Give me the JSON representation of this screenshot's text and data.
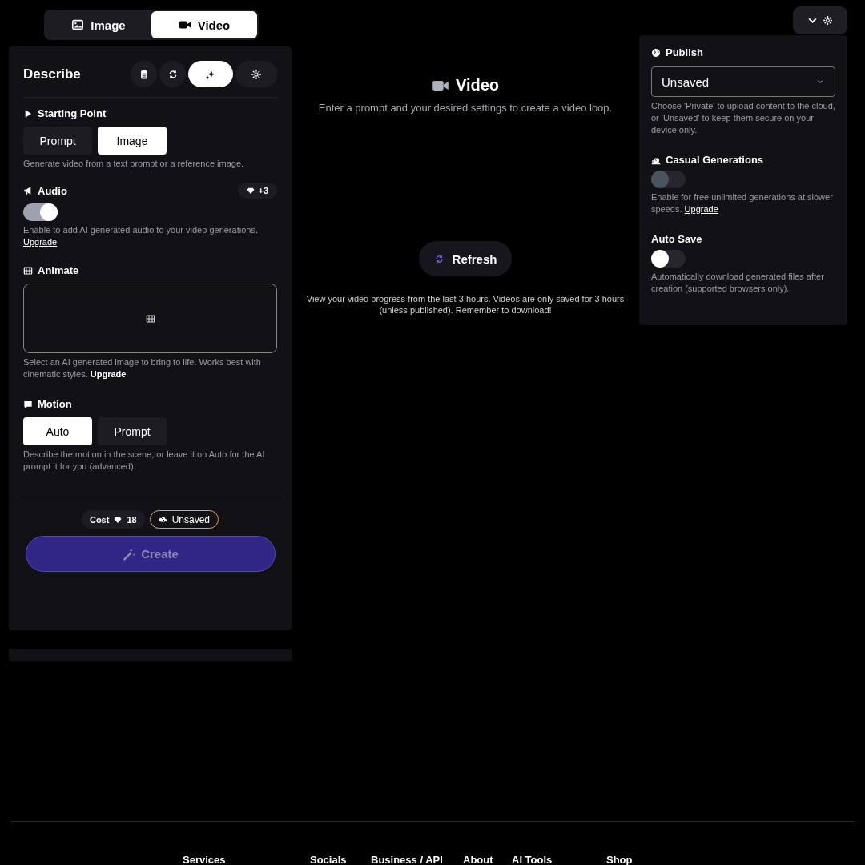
{
  "mode_tabs": [
    {
      "label": "Image",
      "selected": false
    },
    {
      "label": "Video",
      "selected": true
    }
  ],
  "describe_panel": {
    "title": "Describe",
    "tools": [
      {
        "selected": false
      },
      {
        "selected": false
      },
      {
        "selected": true
      },
      {
        "selected": false
      }
    ],
    "starting_point": {
      "title": "Starting Point",
      "options": [
        {
          "label": "Prompt",
          "selected": false
        },
        {
          "label": "Image",
          "selected": true
        }
      ],
      "hint": "Generate video from a text prompt or a reference image."
    },
    "audio": {
      "title": "Audio",
      "badge": "+3",
      "on": true,
      "hint": "Enable to add AI generated audio to your video generations.",
      "link": "Upgrade"
    },
    "animate": {
      "title": "Animate",
      "hint": "Select an AI generated image to bring to life. Works best with cinematic styles.",
      "link": "Upgrade"
    },
    "motion": {
      "title": "Motion",
      "options": [
        {
          "label": "Auto",
          "selected": true
        },
        {
          "label": "Prompt",
          "selected": false
        }
      ],
      "hint": "Describe the motion in the scene, or leave it on Auto for the AI prompt it for you (advanced)."
    },
    "cost_label": "Cost",
    "cost_value": "18",
    "save_status": "Unsaved",
    "create_button": {
      "label": "Create",
      "disabled": true
    }
  },
  "center": {
    "title": "Video",
    "subtitle": "Enter a prompt and your desired settings to create a video loop.",
    "refresh_button": "Refresh",
    "note": "View your video progress from the last 3 hours. Videos are only saved for 3 hours (unless published). Remember to download!"
  },
  "settings_panel": {
    "publish": {
      "title": "Publish",
      "value": "Unsaved",
      "hint": "Choose 'Private' to upload content to the cloud, or 'Unsaved' to keep them secure on your device only."
    },
    "casual_generations": {
      "title": "Casual Generations",
      "on": false,
      "disabled": true,
      "hint": "Enable for free unlimited generations at slower speeds.",
      "link": "Upgrade"
    },
    "auto_save": {
      "title": "Auto Save",
      "on": false,
      "disabled": false,
      "hint": "Automatically download generated files after creation (supported browsers only)."
    }
  },
  "footer_headings": [
    "Services",
    "Socials",
    "Business / API",
    "About",
    "AI Tools",
    "Shop"
  ]
}
